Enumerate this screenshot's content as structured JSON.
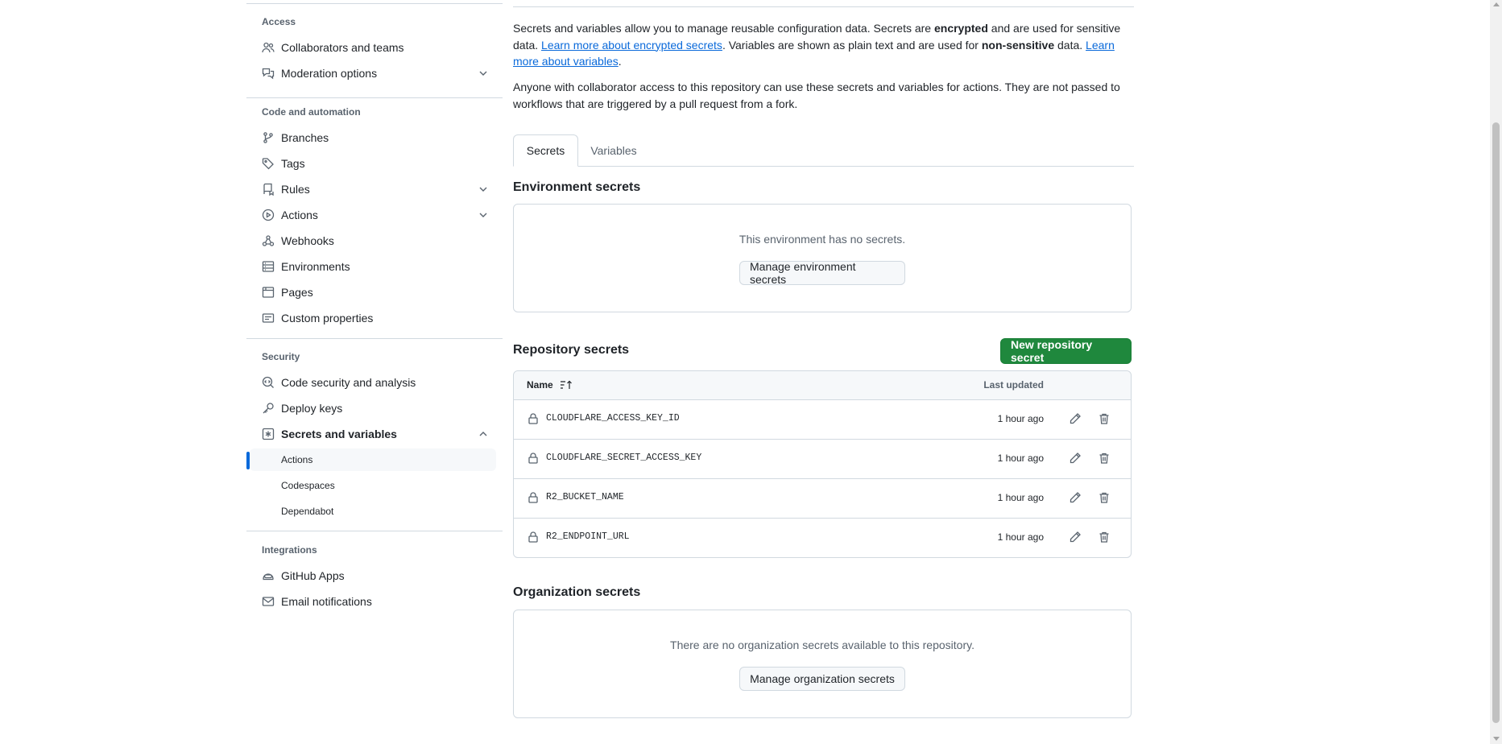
{
  "sidebar": {
    "access": {
      "title": "Access",
      "items": [
        {
          "label": "Collaborators and teams",
          "icon": "people-icon"
        },
        {
          "label": "Moderation options",
          "icon": "comment-discussion-icon",
          "expandable": true
        }
      ]
    },
    "code": {
      "title": "Code and automation",
      "items": [
        {
          "label": "Branches",
          "icon": "git-branch-icon"
        },
        {
          "label": "Tags",
          "icon": "tag-icon"
        },
        {
          "label": "Rules",
          "icon": "repo-push-icon",
          "expandable": true
        },
        {
          "label": "Actions",
          "icon": "play-icon",
          "expandable": true
        },
        {
          "label": "Webhooks",
          "icon": "webhook-icon"
        },
        {
          "label": "Environments",
          "icon": "server-icon"
        },
        {
          "label": "Pages",
          "icon": "browser-icon"
        },
        {
          "label": "Custom properties",
          "icon": "note-icon"
        }
      ]
    },
    "security": {
      "title": "Security",
      "items": [
        {
          "label": "Code security and analysis",
          "icon": "codescan-icon"
        },
        {
          "label": "Deploy keys",
          "icon": "key-icon"
        },
        {
          "label": "Secrets and variables",
          "icon": "key-asterisk-icon",
          "expanded": true
        }
      ],
      "sub_items": [
        {
          "label": "Actions",
          "active": true
        },
        {
          "label": "Codespaces"
        },
        {
          "label": "Dependabot"
        }
      ]
    },
    "integrations": {
      "title": "Integrations",
      "items": [
        {
          "label": "GitHub Apps",
          "icon": "hubot-icon"
        },
        {
          "label": "Email notifications",
          "icon": "mail-icon"
        }
      ]
    }
  },
  "intro": {
    "p1_a": "Secrets and variables allow you to manage reusable configuration data. Secrets are ",
    "p1_b": "encrypted",
    "p1_c": " and are used for sensitive data. ",
    "p1_link1": "Learn more about encrypted secrets",
    "p1_d": ". Variables are shown as plain text and are used for ",
    "p1_e": "non-sensitive",
    "p1_f": " data. ",
    "p1_link2": "Learn more about variables",
    "p1_g": ".",
    "p2": "Anyone with collaborator access to this repository can use these secrets and variables for actions. They are not passed to workflows that are triggered by a pull request from a fork."
  },
  "tabs": [
    {
      "label": "Secrets",
      "selected": true
    },
    {
      "label": "Variables"
    }
  ],
  "environment": {
    "title": "Environment secrets",
    "empty_text": "This environment has no secrets.",
    "button": "Manage environment secrets"
  },
  "repository": {
    "title": "Repository secrets",
    "new_button": "New repository secret",
    "col_name": "Name",
    "col_updated": "Last updated",
    "rows": [
      {
        "name": "CLOUDFLARE_ACCESS_KEY_ID",
        "updated": "1 hour ago"
      },
      {
        "name": "CLOUDFLARE_SECRET_ACCESS_KEY",
        "updated": "1 hour ago"
      },
      {
        "name": "R2_BUCKET_NAME",
        "updated": "1 hour ago"
      },
      {
        "name": "R2_ENDPOINT_URL",
        "updated": "1 hour ago"
      }
    ]
  },
  "organization": {
    "title": "Organization secrets",
    "empty_text": "There are no organization secrets available to this repository.",
    "button": "Manage organization secrets"
  },
  "colors": {
    "accent": "#0969da",
    "primary_button": "#1f883d",
    "border": "#d1d9e0",
    "muted_text": "#59636e"
  }
}
